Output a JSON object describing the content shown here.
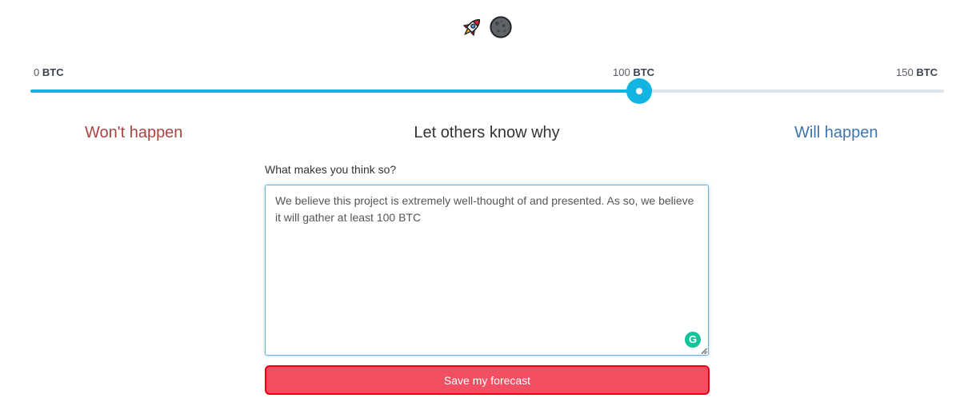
{
  "icons": {
    "rocket": "rocket-icon",
    "moon": "moon-icon"
  },
  "scale": {
    "min_value": "0",
    "mid_value": "100",
    "max_value": "150",
    "unit": "BTC"
  },
  "slider": {
    "min": 0,
    "max": 150,
    "value": 100,
    "fill_color": "#12b4e1",
    "track_color": "#dfe3ea"
  },
  "outcomes": {
    "wont": "Won't happen",
    "will": "Will happen"
  },
  "heading": "Let others know why",
  "form": {
    "question": "What makes you think so?",
    "answer": "We believe this project is extremely well-thought of and presented. As so, we believe it will gather at least 100 BTC"
  },
  "save_label": "Save my forecast",
  "colors": {
    "wont": "#a94442",
    "will": "#3e74b2",
    "button": "#f24f63",
    "button_border": "#e60012"
  }
}
